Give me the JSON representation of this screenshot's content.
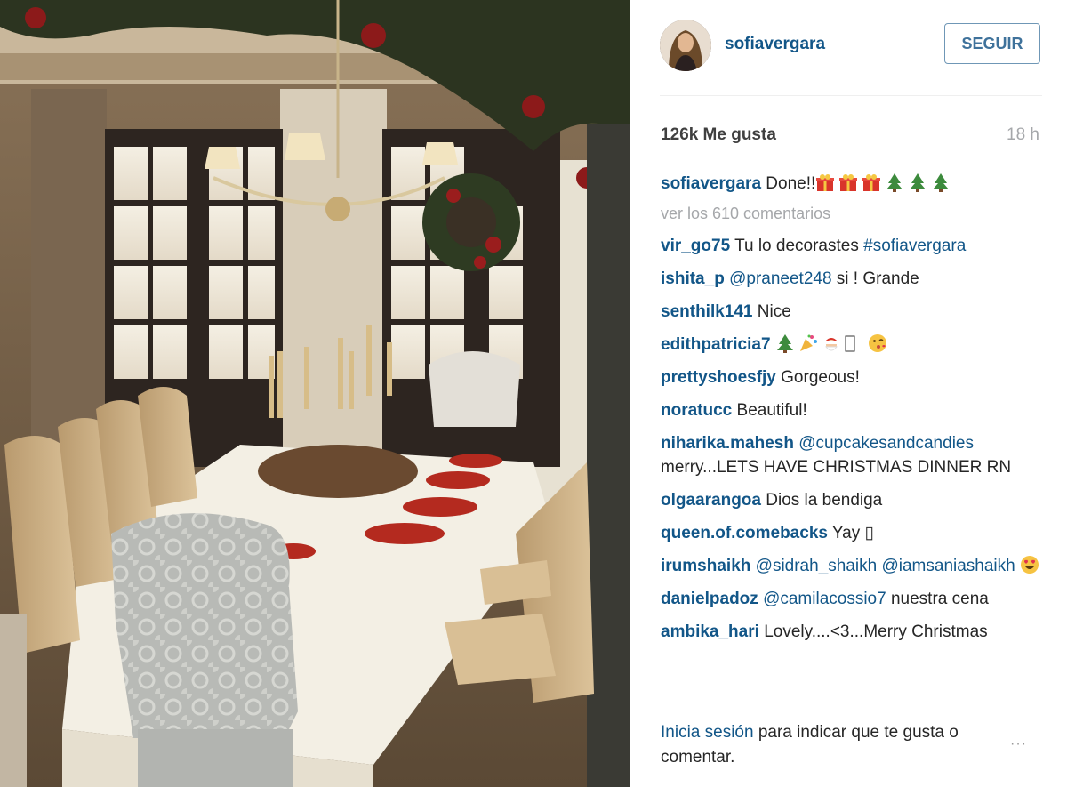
{
  "post": {
    "username": "sofiavergara",
    "follow_label": "SEGUIR",
    "likes": "126k Me gusta",
    "time_ago": "18 h",
    "caption_text": "Done!!",
    "caption_emojis": [
      "gift-icon",
      "gift-icon",
      "gift-icon",
      "christmas-tree-icon",
      "christmas-tree-icon",
      "christmas-tree-icon"
    ],
    "view_all_comments": "ver los 610 comentarios"
  },
  "comments": [
    {
      "user": "vir_go75",
      "text": "Tu lo decorastes ",
      "mention": "#sofiavergara"
    },
    {
      "user": "ishita_p",
      "mention": "@praneet248",
      "text": " si ! Grande"
    },
    {
      "user": "senthilk141",
      "text": "Nice"
    },
    {
      "user": "edithpatricia7",
      "text": ""
    },
    {
      "user": "prettyshoesfjy",
      "text": "Gorgeous!"
    },
    {
      "user": "noratucc",
      "text": "Beautiful!"
    },
    {
      "user": "niharika.mahesh",
      "mention": "@cupcakesandcandies",
      "text": "merry...LETS HAVE CHRISTMAS DINNER RN"
    },
    {
      "user": "olgaarangoa",
      "text": "Dios la bendiga"
    },
    {
      "user": "queen.of.comebacks",
      "text": "Yay ▯"
    },
    {
      "user": "irumshaikh",
      "mention": "@sidrah_shaikh",
      "mention2": "@iamsaniashaikh"
    },
    {
      "user": "danielpadoz",
      "mention": "@camilacossio7",
      "text": " nuestra cena"
    },
    {
      "user": "ambika_hari",
      "text": "Lovely....<3...Merry Christmas"
    }
  ],
  "footer": {
    "login_link": "Inicia sesión",
    "login_text": " para indicar que te gusta o comentar.",
    "more_label": "···"
  },
  "colors": {
    "link_blue": "#125688",
    "follow_blue": "#3f729b",
    "muted_gray": "#a5a7aa"
  }
}
